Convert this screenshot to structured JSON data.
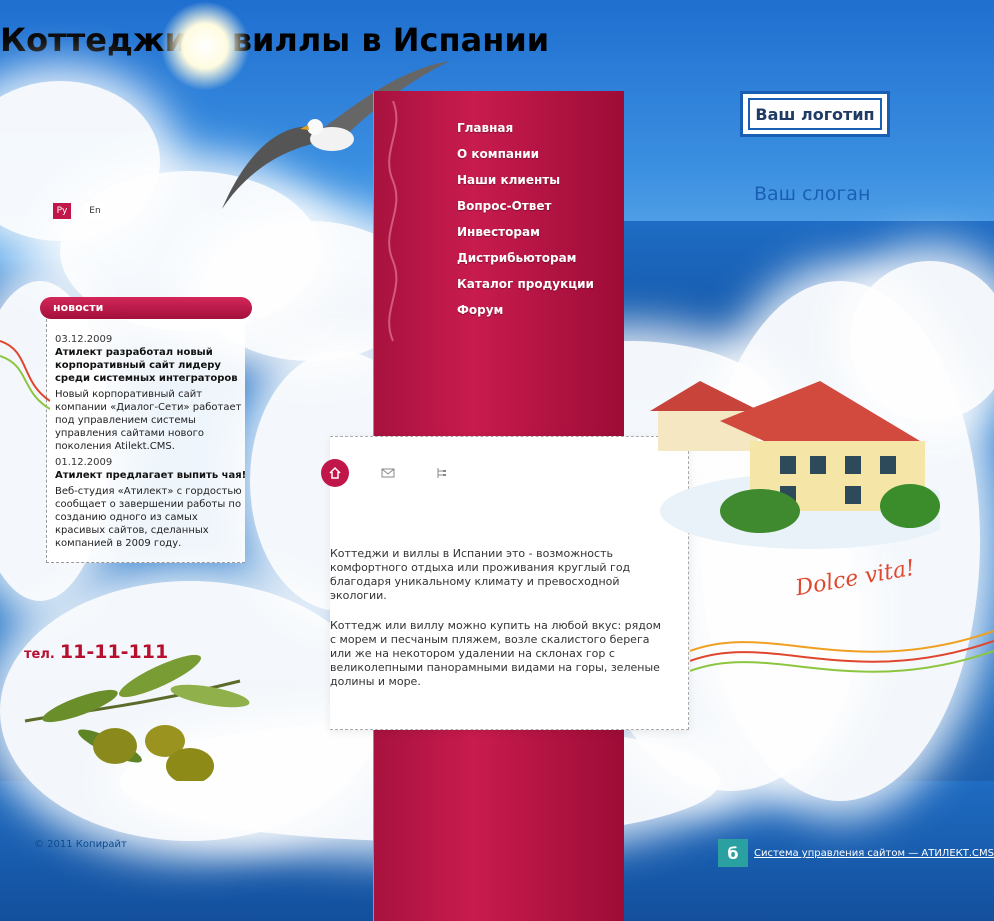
{
  "header": {
    "logo_text": "Ваш логотип",
    "slogan": "Ваш слоган",
    "languages": [
      "Ру",
      "En"
    ]
  },
  "menu": {
    "items": [
      "Главная",
      "О компании",
      "Наши клиенты",
      "Вопрос-Ответ",
      "Инвесторам",
      "Дистрибьюторам",
      "Каталог продукции",
      "Форум"
    ]
  },
  "news": {
    "heading": "новости",
    "items": [
      {
        "date": "03.12.2009",
        "title": "Атилект разработал новый корпоративный сайт лидеру среди системных интеграторов",
        "text": "Новый корпоративный сайт компании «Диалог-Сети» работает под управлением системы управления сайтами нового поколения Atilekt.CMS."
      },
      {
        "date": "01.12.2009",
        "title": "Атилект предлагает выпить чая!",
        "text": "Веб-студия «Атилект» с гордостью сообщает о завершении работы по созданию одного из самых красивых сайтов, сделанных компанией в 2009 году."
      }
    ]
  },
  "contact": {
    "phone_prefix": "тел.",
    "phone_number": "11-11-111"
  },
  "content": {
    "icons": [
      "home-icon",
      "mail-icon",
      "sitemap-icon"
    ],
    "title": "Коттеджи и виллы в Испании",
    "paragraphs": [
      "Коттеджи и виллы в Испании это - возможность комфортного отдыха или проживания круглый год благодаря уникальному климату и превосходной экологии.",
      "Коттедж или виллу можно купить на любой вкус: рядом с морем и песчаным пляжем, возле скалистого берега или же на некотором удалении на склонах гор с великолепными панорамными видами на горы, зеленые долины и море."
    ]
  },
  "decor": {
    "dolce_text": "Dolce vita!"
  },
  "footer": {
    "copyright": "© 2011 Копирайт",
    "cms_link": "Система управления сайтом — АТИЛЕКТ.CMS"
  },
  "colors": {
    "accent": "#c0164a",
    "brand_blue": "#1a5fb4"
  }
}
